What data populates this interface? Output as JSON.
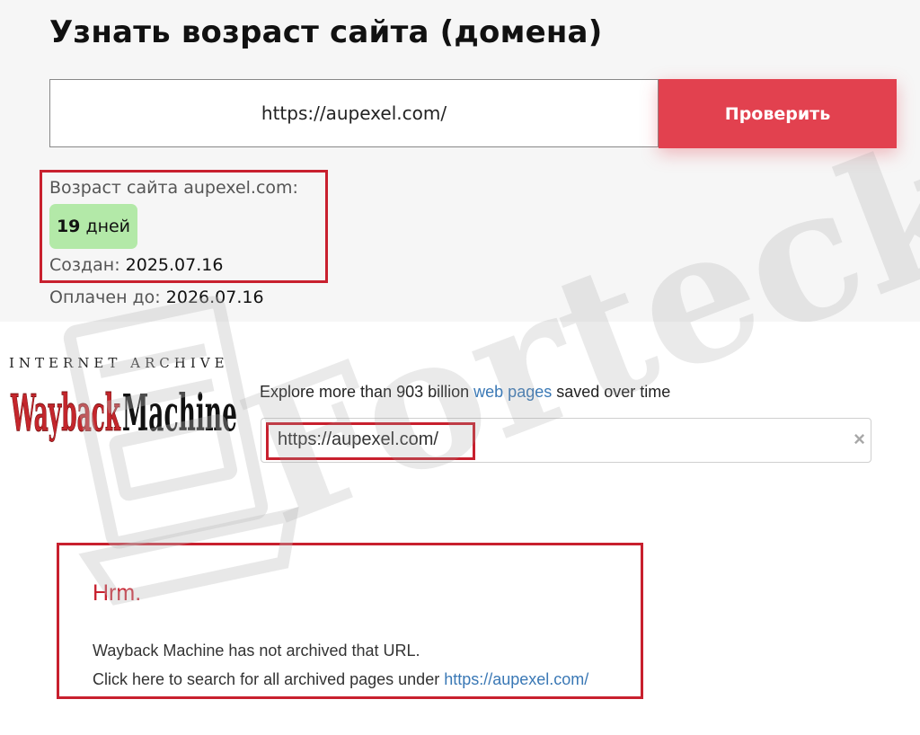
{
  "checker": {
    "title": "Узнать возраст сайта (домена)",
    "input_value": "https://aupexel.com/",
    "button_label": "Проверить",
    "age_label": "Возраст сайта aupexel.com:",
    "age_number": "19",
    "age_unit": "дней",
    "created_label": "Создан:",
    "created_value": "2025.07.16",
    "paid_label": "Оплачен до:",
    "paid_value": "2026.07.16"
  },
  "wayback": {
    "logo_top": "INTERNET ARCHIVE",
    "logo_word1": "Wayback",
    "logo_word2": "Machine",
    "tagline_before": "Explore more than 903 billion",
    "tagline_link": "web pages",
    "tagline_after": "saved over time",
    "search_value": "https://aupexel.com/",
    "clear_icon": "×",
    "result_title": "Hrm.",
    "result_line1": "Wayback Machine has not archived that URL.",
    "result_line2_text": "Click here to search for all archived pages under",
    "result_line2_link": "https://aupexel.com/"
  },
  "watermark": {
    "text": "Forteck",
    "icon": "laptop-icon"
  },
  "colors": {
    "accent_red": "#e2414f",
    "frame_red": "#c8202e",
    "badge_green": "#b3e9a8",
    "link_blue": "#3a78b5",
    "wayback_red": "#c4262c"
  }
}
